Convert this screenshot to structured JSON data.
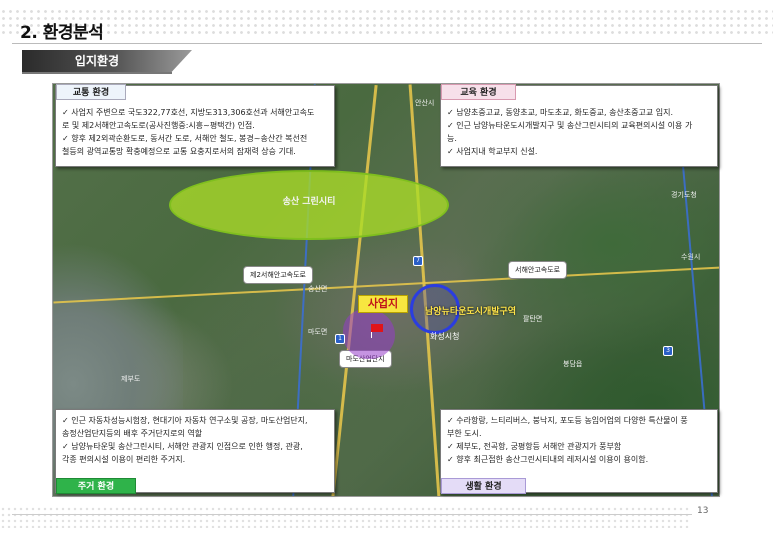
{
  "page": {
    "title": "2. 환경분석",
    "subheading": "입지환경",
    "page_number": "13"
  },
  "tags": {
    "traffic": "교통 환경",
    "education": "교육 환경",
    "residential": "주거 환경",
    "living": "생활 환경"
  },
  "traffic_box": {
    "lines": [
      "✓ 사업지 주변으로 국도322,77호선, 지방도313,306호선과 서해안고속도",
      "로 및 제2서해안고속도로(공사진행중:시흥~평택간) 인접.",
      "✓ 향후 제2외곽순환도로, 동서간 도로, 서해안 철도, 봉경~송산간 복선전",
      "철등의 광역교통망 확충예정으로 교통 요충지로서의 잠재력 상승 기대."
    ]
  },
  "education_box": {
    "lines": [
      "✓ 남양초중고교, 동양초교, 마도초교, 화도중교, 송산초중고교 입지.",
      "✓ 인근 남양뉴타운도시개발지구 및 송산그린시티의 교육편의시설 이용 가",
      "능.",
      "✓ 사업지내 학교부지 신설."
    ]
  },
  "residential_box": {
    "lines": [
      "✓ 인근 자동차성능시험장, 현대기아 자동차 연구소및 공장, 마도산업단지,",
      "송정산업단지등의 배후 주거단지로의 역할",
      "✓ 남양뉴타운및 송산그린시티, 서해안 관광지 인접으로 인한 행정, 관광,",
      "각종 편의시설 이용이 편리한 주거지."
    ]
  },
  "living_box": {
    "lines": [
      "✓ 수라항랑, 느티리버스, 붕낙지, 포도등 농임어업의 다양한 특산물이 풍",
      "부한 도시.",
      "✓ 제부도, 전곡항, 궁평항등 서해안 관광지가 풍부함",
      "✓ 향후 최근접한 송산그린시티내의 레저시설 이용이 용이함."
    ]
  },
  "map": {
    "green_area_label": "송산 그린시티",
    "site_label": "사업지",
    "newtown_label": "남양뉴타운도시개발구역",
    "hwaseong_label": "화성시청",
    "callout_left": "제2서해안고속도로",
    "callout_right": "서해안고속도로",
    "callout_industrial": "마도산업단지",
    "place_labels": [
      "안산시",
      "경기도청",
      "수원시",
      "제부도",
      "마도면",
      "송산면",
      "팔탄면",
      "봉담읍"
    ]
  },
  "colors": {
    "green_area": "#aadc28",
    "site_badge": "#f7e640",
    "site_text": "#c0141a",
    "newtown_ring": "#2b3de0",
    "residential_tag": "#2fb34a"
  }
}
